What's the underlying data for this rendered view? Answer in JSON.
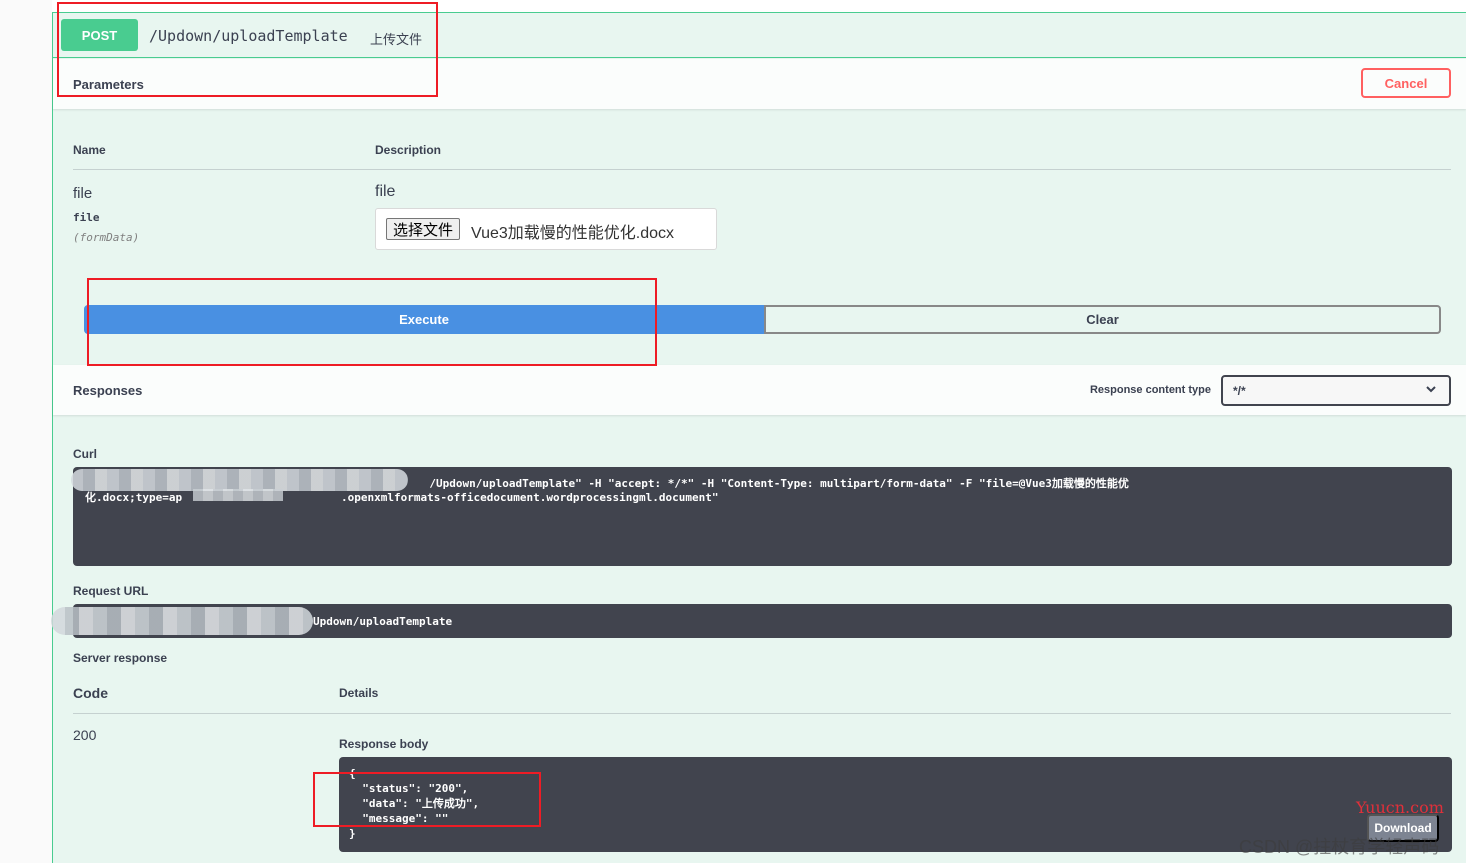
{
  "operation": {
    "method": "POST",
    "path": "/Updown/uploadTemplate",
    "summary": "上传文件"
  },
  "parameters_section": {
    "title": "Parameters",
    "cancel_label": "Cancel",
    "col_name": "Name",
    "col_description": "Description",
    "param": {
      "name": "file",
      "type": "file",
      "in": "(formData)",
      "description": "file",
      "file_button_label": "选择文件",
      "file_name": "Vue3加载慢的性能优化.docx"
    }
  },
  "actions": {
    "execute_label": "Execute",
    "clear_label": "Clear"
  },
  "responses_section": {
    "title": "Responses",
    "content_type_label": "Response content type",
    "content_type_value": "*/*"
  },
  "curl": {
    "label": "Curl",
    "text": "                                                    /Updown/uploadTemplate\" -H \"accept: */*\" -H \"Content-Type: multipart/form-data\" -F \"file=@Vue3加载慢的性能优\n化.docx;type=ap                        .openxmlformats-officedocument.wordprocessingml.document\""
  },
  "request_url": {
    "label": "Request URL",
    "value": "Updown/uploadTemplate"
  },
  "server_response": {
    "label": "Server response",
    "col_code": "Code",
    "col_details": "Details",
    "code": "200",
    "body_label": "Response body",
    "body": "{\n  \"status\": \"200\",\n  \"data\": \"上传成功\",\n  \"message\": \"\"\n}",
    "download_label": "Download"
  },
  "watermarks": {
    "site": "Yuucn.com",
    "csdn": "CSDN @拄杖育学轻声码"
  },
  "colors": {
    "post_green": "#49cc90",
    "execute_blue": "#4990e2",
    "cancel_red": "#ff6060",
    "highlight_red": "#ee1c25",
    "code_bg": "#41444e"
  }
}
